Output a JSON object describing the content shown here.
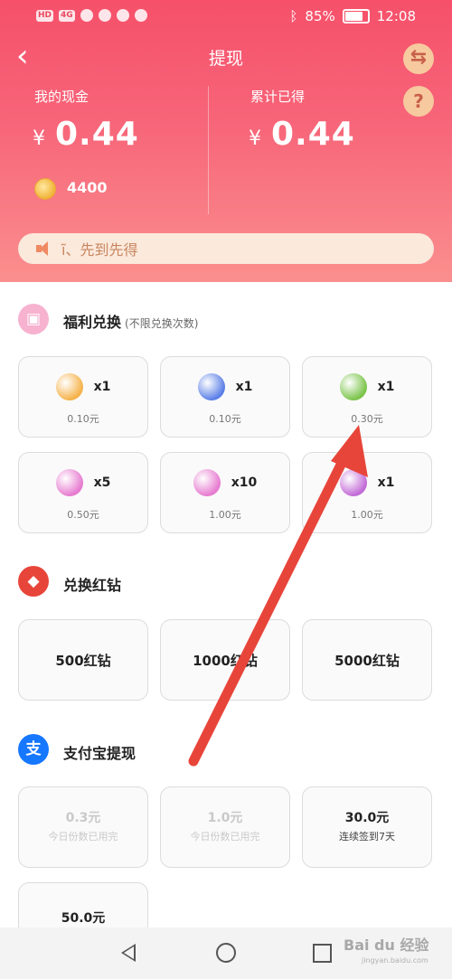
{
  "status_bar": {
    "time": "12:08",
    "battery": "85%",
    "chips": [
      "HD",
      "4G"
    ]
  },
  "header": {
    "title": "提现",
    "my_cash_label": "我的现金",
    "my_cash_value": "0.44",
    "total_label": "累计已得",
    "total_value": "0.44",
    "currency": "¥",
    "coins": "4400",
    "notice": "ĩ、先到先得",
    "back_glyph": "‹",
    "swap_glyph": "⇆",
    "help_glyph": "?"
  },
  "welfare": {
    "title": "福利兑换",
    "subtitle": "(不限兑换次数)",
    "items": [
      {
        "qty": "x1",
        "price": "0.10元",
        "icon": "gift-hands-icon",
        "color": "#f5b24a"
      },
      {
        "qty": "x1",
        "price": "0.10元",
        "icon": "heart-wand-icon",
        "color": "#5b7fe6"
      },
      {
        "qty": "x1",
        "price": "0.30元",
        "icon": "potion-jar-icon",
        "color": "#7bc44a"
      },
      {
        "qty": "x5",
        "price": "0.50元",
        "icon": "lollipop-icon",
        "color": "#e77bd0"
      },
      {
        "qty": "x10",
        "price": "1.00元",
        "icon": "lollipop-icon",
        "color": "#e77bd0"
      },
      {
        "qty": "x1",
        "price": "1.00元",
        "icon": "card-icon",
        "color": "#c26ad6"
      }
    ]
  },
  "diamond": {
    "title": "兑换红钻",
    "items": [
      "500红钻",
      "1000红钻",
      "5000红钻"
    ]
  },
  "alipay": {
    "title": "支付宝提现",
    "icon_glyph": "支",
    "items": [
      {
        "amount": "0.3元",
        "note": "今日份数已用完",
        "disabled": true
      },
      {
        "amount": "1.0元",
        "note": "今日份数已用完",
        "disabled": true
      },
      {
        "amount": "30.0元",
        "note": "连续签到7天",
        "disabled": false
      },
      {
        "amount": "50.0元",
        "note": "",
        "disabled": false
      }
    ]
  },
  "watermark": {
    "text": "Bai du 经验",
    "sub": "jingyan.baidu.com"
  },
  "colors": {
    "accent": "#f6506a",
    "arrow": "#e8453a",
    "alipay": "#1677ff"
  }
}
